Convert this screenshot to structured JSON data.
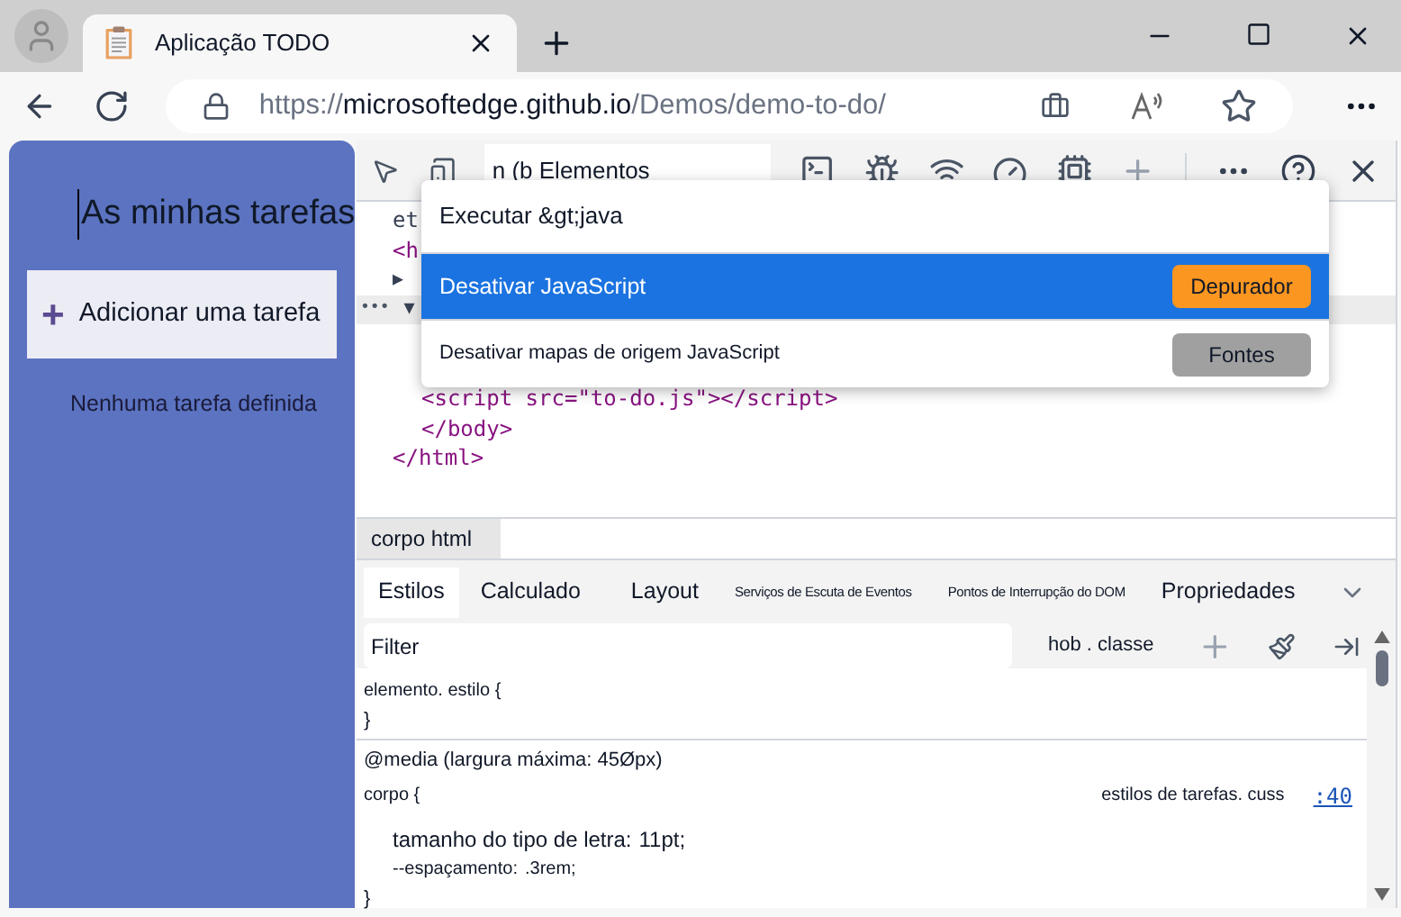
{
  "browser": {
    "tab_title": "Aplicação TODO",
    "url_scheme": "https://",
    "url_host": "microsoftedge.github.io",
    "url_path": "/Demos/demo-to-do/"
  },
  "app": {
    "title": "As minhas tarefas",
    "add_label": "Adicionar uma tarefa",
    "add_symbol": "+",
    "empty_text": "Nenhuma tarefa definida"
  },
  "devtools": {
    "panel_tab": "n (b Elementos",
    "dom_lines": [
      {
        "text": "et",
        "kind": "plain"
      },
      {
        "text": "<h",
        "kind": "tag"
      },
      {
        "text": "▶",
        "kind": "arrow"
      },
      {
        "text": "▼",
        "kind": "ellipsis",
        "prefix": "•••"
      },
      {
        "text": "<script src=\"to-do.js\"></script>",
        "kind": "tag",
        "indent": true
      },
      {
        "text": "</body>",
        "kind": "tag",
        "indent": true
      },
      {
        "text": "</html>",
        "kind": "tag"
      }
    ],
    "menu": [
      {
        "label": "Executar &gt;java",
        "selected": false
      },
      {
        "label": "Desativar JavaScript",
        "selected": true,
        "action": "Depurador",
        "color": "#fb9620"
      },
      {
        "label": "Desativar mapas de origem JavaScript",
        "selected": false,
        "action": "Fontes",
        "color": "#a0a0a0"
      }
    ],
    "breadcrumb": "corpo html",
    "tabs": [
      {
        "label": "Estilos",
        "selected": true,
        "small": false
      },
      {
        "label": "Calculado",
        "selected": false,
        "small": false
      },
      {
        "label": "Layout",
        "selected": false,
        "small": false
      },
      {
        "label": "Serviços de Escuta de Eventos",
        "selected": false,
        "small": true
      },
      {
        "label": "Pontos de Interrupção do DOM",
        "selected": false,
        "small": true
      },
      {
        "label": "Propriedades",
        "selected": false,
        "small": false
      }
    ],
    "filter": {
      "placeholder": "Filter",
      "hov_cls": "hob . classe"
    },
    "rules": [
      {
        "selector": "elemento. estilo {",
        "close": "}"
      },
      {
        "media": "@media (largura máxima: 45Øpx)",
        "selector": "corpo {",
        "source": "estilos de tarefas. cuss",
        "line": ":40",
        "props": [
          {
            "name": "tamanho do tipo de letra:",
            "value": "11pt;",
            "large": true
          },
          {
            "name": "--espaçamento:",
            "value": ".3rem;",
            "large": false
          }
        ],
        "close": "}"
      }
    ]
  }
}
